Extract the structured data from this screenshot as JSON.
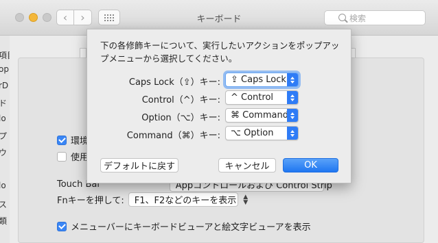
{
  "window": {
    "title": "キーボード",
    "search_placeholder": "検索"
  },
  "sidebar_fragments": [
    "項目",
    "op",
    "rD",
    "ド",
    "lo",
    "プ",
    "ウ",
    "lo",
    "ス",
    "類"
  ],
  "background": {
    "checkbox1_label": "環境設",
    "checkbox2_label": "使用し",
    "touchbar_label": "Touch Bar",
    "touchbar_value": "Appコントロールおよび Control Strip",
    "fn_label": "Fnキーを押して:",
    "fn_value": "F1、F2などのキーを表示",
    "menubar_checkbox_label": "メニューバーにキーボードビューアと絵文字ビューアを表示"
  },
  "sheet": {
    "message": "下の各修飾キーについて、実行したいアクションをポップアップメニューから選択してください。",
    "rows": [
      {
        "label": "Caps Lock（⇪）キー:",
        "value": "⇪ Caps Lock"
      },
      {
        "label": "Control（^）キー:",
        "value": "^ Control"
      },
      {
        "label": "Option（⌥）キー:",
        "value": "⌘ Command"
      },
      {
        "label": "Command（⌘）キー:",
        "value": "⌥ Option"
      }
    ],
    "default_button": "デフォルトに戻す",
    "cancel_button": "キャンセル",
    "ok_button": "OK"
  },
  "colors": {
    "accent": "#2f7cf6",
    "sheet_bg": "#ececec",
    "window_bg": "#e3e3e3"
  }
}
